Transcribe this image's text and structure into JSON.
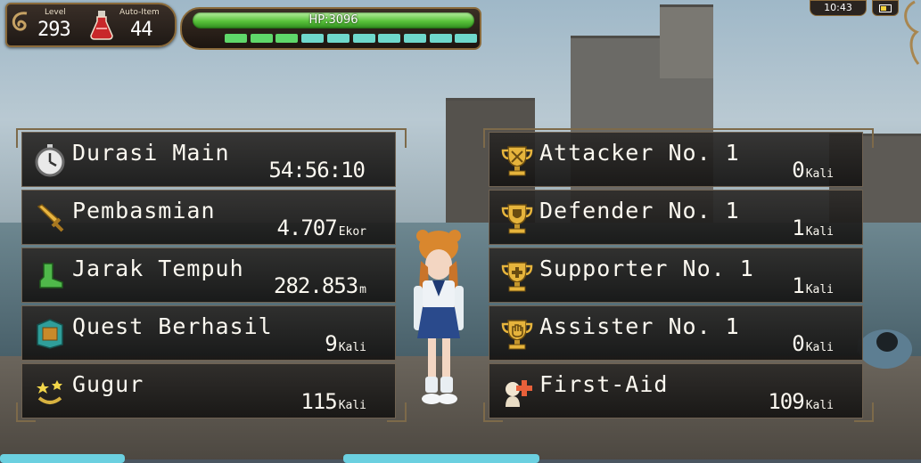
{
  "hud": {
    "level_label": "Level",
    "level_value": "293",
    "auto_item_label": "Auto-Item",
    "auto_item_value": "44",
    "hp_text": "HP:3096",
    "clock": "10:43",
    "segment_colors": [
      "#5fd86a",
      "#5fd86a",
      "#5fd86a",
      "#6fd8cc",
      "#6fd8cc",
      "#6fd8cc",
      "#6fd8cc",
      "#6fd8cc",
      "#6fd8cc",
      "#6fd8cc"
    ]
  },
  "left_stats": [
    {
      "label": "Durasi Main",
      "value": "54:56:10",
      "unit": "",
      "icon": "stopwatch-icon"
    },
    {
      "label": "Pembasmian",
      "value": "4.707",
      "unit": "Ekor",
      "icon": "sword-icon"
    },
    {
      "label": "Jarak Tempuh",
      "value": "282.853",
      "unit": "m",
      "icon": "boot-icon"
    },
    {
      "label": "Quest Berhasil",
      "value": "9",
      "unit": "Kali",
      "icon": "quest-book-icon"
    },
    {
      "label": "Gugur",
      "value": "115",
      "unit": "Kali",
      "icon": "knocked-out-icon"
    }
  ],
  "right_stats": [
    {
      "label": "Attacker No. 1",
      "value": "0",
      "unit": "Kali",
      "icon": "trophy-attacker-icon"
    },
    {
      "label": "Defender No. 1",
      "value": "1",
      "unit": "Kali",
      "icon": "trophy-defender-icon"
    },
    {
      "label": "Supporter No. 1",
      "value": "1",
      "unit": "Kali",
      "icon": "trophy-supporter-icon"
    },
    {
      "label": "Assister No. 1",
      "value": "0",
      "unit": "Kali",
      "icon": "trophy-assister-icon"
    },
    {
      "label": "First-Aid",
      "value": "109",
      "unit": "Kali",
      "icon": "first-aid-icon"
    }
  ]
}
